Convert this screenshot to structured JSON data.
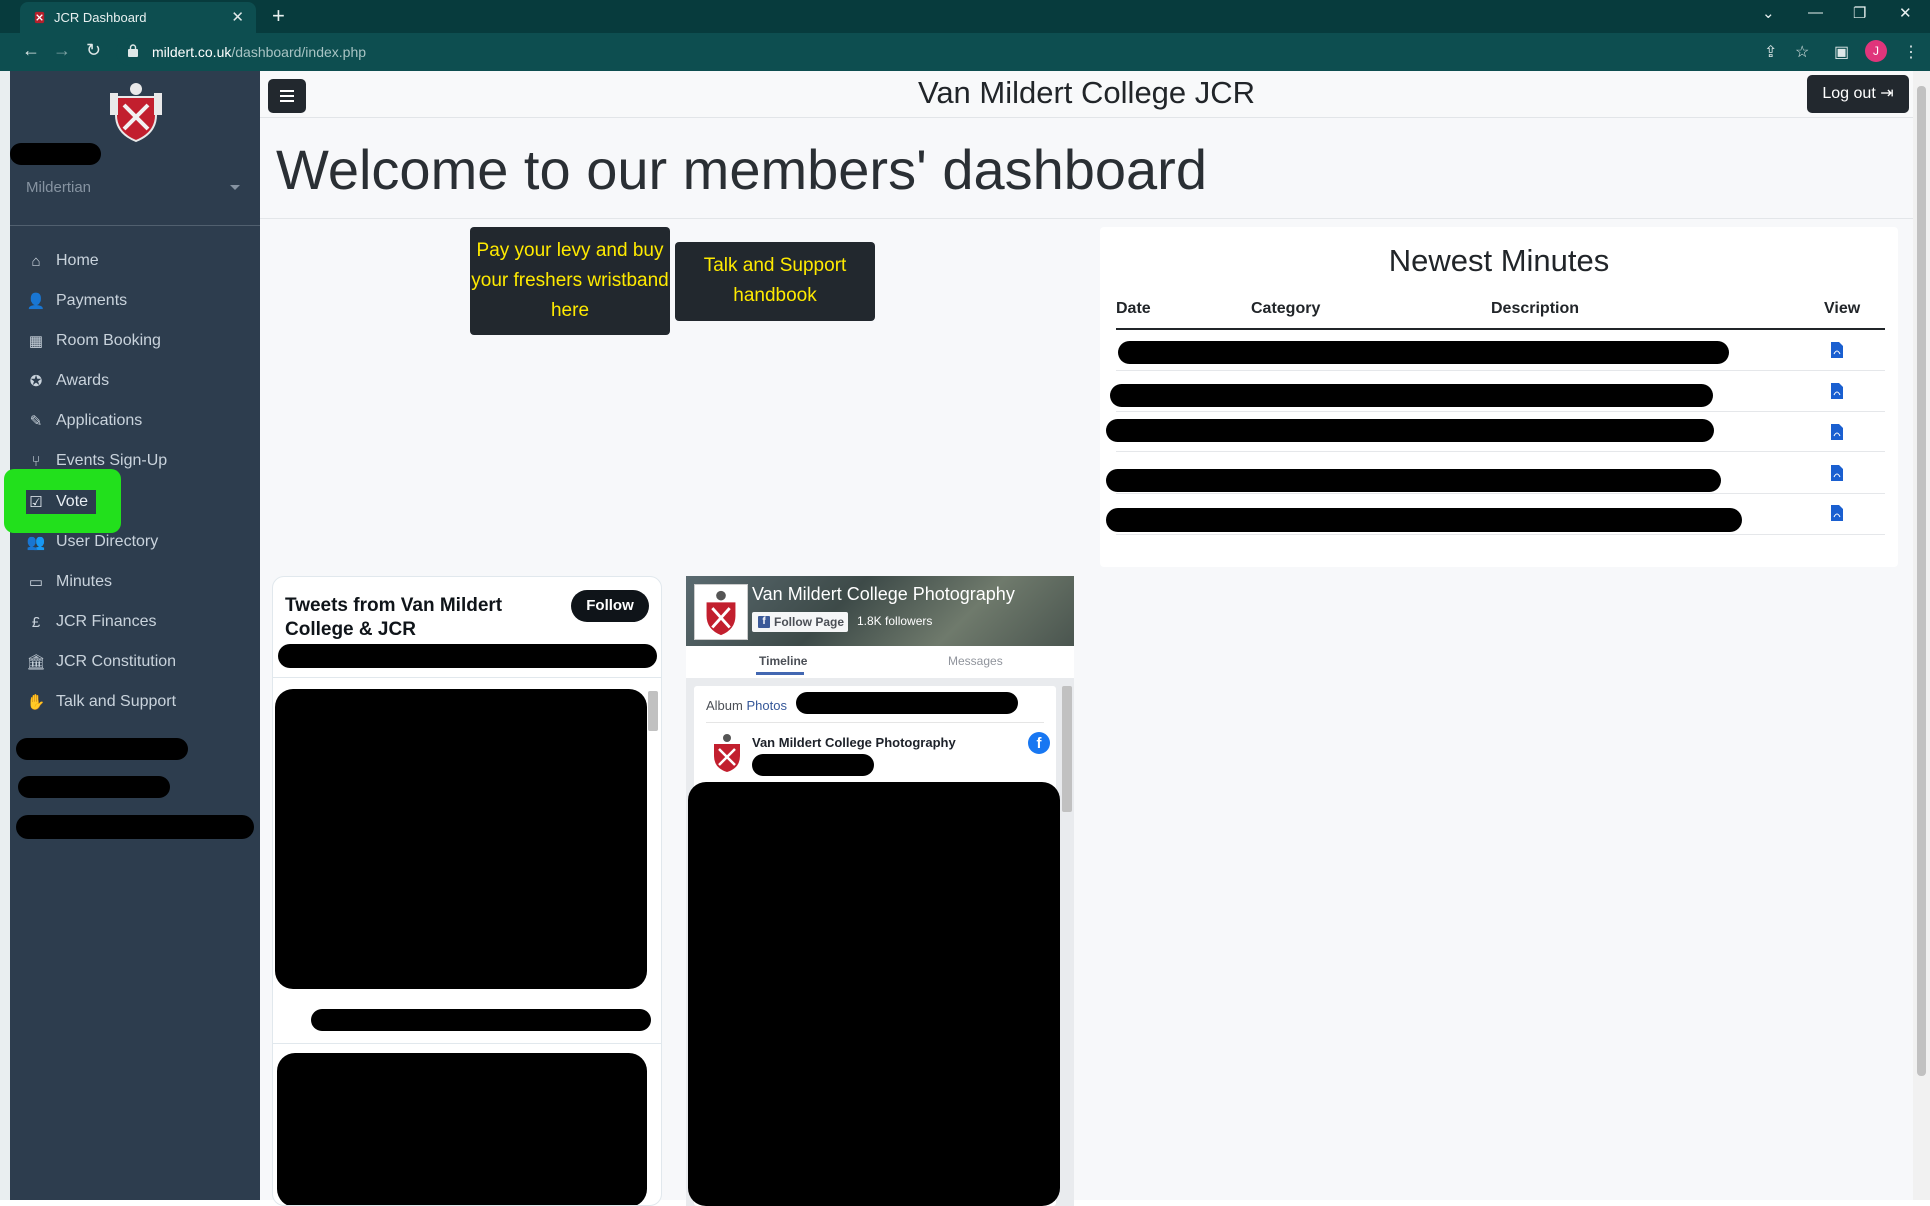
{
  "browser": {
    "tab_title": "JCR Dashboard",
    "tab_close": "✕",
    "new_tab": "+",
    "url_domain": "mildert.co.uk",
    "url_path": "/dashboard/index.php",
    "profile_initial": "J"
  },
  "sidebar": {
    "user_role": "Mildertian",
    "items": [
      {
        "label": "Home",
        "icon": "home-icon"
      },
      {
        "label": "Payments",
        "icon": "user-check-icon"
      },
      {
        "label": "Room Booking",
        "icon": "calendar-check-icon"
      },
      {
        "label": "Awards",
        "icon": "award-icon"
      },
      {
        "label": "Applications",
        "icon": "pen-icon"
      },
      {
        "label": "Events Sign-Up",
        "icon": "utensils-icon"
      },
      {
        "label": "Vote",
        "icon": "vote-icon"
      },
      {
        "label": "User Directory",
        "icon": "users-icon"
      },
      {
        "label": "Minutes",
        "icon": "file-icon"
      },
      {
        "label": "JCR Finances",
        "icon": "pound-icon"
      },
      {
        "label": "JCR Constitution",
        "icon": "landmark-icon"
      },
      {
        "label": "Talk and Support",
        "icon": "hands-icon"
      }
    ],
    "highlight_color": "#22e01c"
  },
  "header": {
    "title": "Van Mildert College JCR",
    "logout_label": "Log out"
  },
  "main": {
    "welcome": "Welcome to our members' dashboard",
    "cta_levy": "Pay your levy and buy your freshers wristband here",
    "cta_support": "Talk and Support handbook",
    "cta_text_color": "#ffea00"
  },
  "minutes": {
    "title": "Newest Minutes",
    "columns": [
      "Date",
      "Category",
      "Description",
      "View"
    ],
    "row_count_visible": 5
  },
  "twitter": {
    "title": "Tweets from Van Mildert College & JCR",
    "follow_label": "Follow"
  },
  "facebook": {
    "page_name": "Van Mildert College Photography",
    "follow_label": "Follow Page",
    "followers": "1.8K followers",
    "tab_timeline": "Timeline",
    "tab_messages": "Messages",
    "album_prefix": "Album",
    "album_link": "Photos",
    "post_author": "Van Mildert College Photography",
    "badge_letter": "f"
  }
}
